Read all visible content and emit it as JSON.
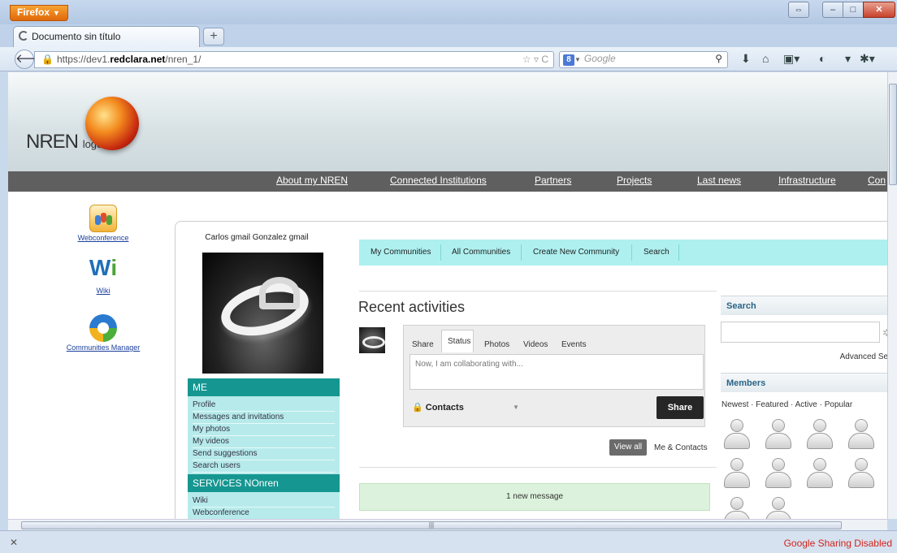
{
  "browser": {
    "menu_button": "Firefox",
    "tab_title": "Documento sin título",
    "url_prefix": "https://dev1.",
    "url_domain": "redclara.net",
    "url_path": "/nren_1/",
    "search_engine_placeholder": "Google",
    "status_text": "Google Sharing Disabled"
  },
  "header": {
    "logo_text": "NREN",
    "logo_small": "logo",
    "menu": [
      "About my NREN",
      "Connected Institutions",
      "Partners",
      "Projects",
      "Last news",
      "Infrastructure",
      "Con"
    ]
  },
  "side_apps": [
    {
      "label": "Webconference",
      "icon": "webconference-icon"
    },
    {
      "label": "Wiki",
      "icon": "wiki-icon"
    },
    {
      "label": "Communities Manager",
      "icon": "communities-manager-icon"
    }
  ],
  "profile": {
    "name": "Carlos gmail Gonzalez gmail"
  },
  "me_menu": {
    "header": "ME",
    "items": [
      "Profile",
      "Messages and invitations",
      "My photos",
      "My videos",
      "Send suggestions",
      "Search users"
    ]
  },
  "services_menu": {
    "header": "SERVICES NOnren",
    "items": [
      "Wiki",
      "Webconference"
    ]
  },
  "community_tabs": [
    "My Communities",
    "All Communities",
    "Create New Community",
    "Search"
  ],
  "activity": {
    "title": "Recent activities",
    "share_tabs": [
      "Share",
      "Status",
      "Photos",
      "Videos",
      "Events"
    ],
    "active_tab": "Status",
    "input_placeholder": "Now, I am collaborating with...",
    "privacy": "Contacts",
    "share_button": "Share",
    "view_all": "View all",
    "filter": "Me & Contacts",
    "new_message": "1 new message"
  },
  "right_panel": {
    "search_header": "Search",
    "advanced_search": "Advanced Sear",
    "members_header": "Members",
    "member_filters": "Newest · Featured · Active · Popular"
  },
  "colors": {
    "menu_teal": "#159691",
    "menu_light": "#b7ebeb",
    "tabs_bg": "#aef0f0",
    "status_red": "#d2231c"
  }
}
